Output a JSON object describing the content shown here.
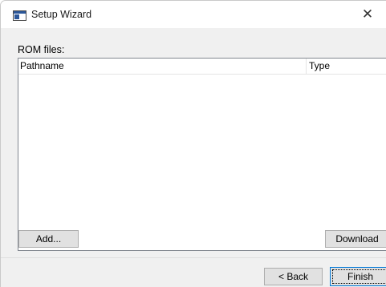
{
  "window": {
    "title": "Setup Wizard",
    "close_glyph": "✕"
  },
  "rom_files": {
    "label": "ROM files:",
    "columns": [
      "Pathname",
      "Type"
    ],
    "rows": []
  },
  "buttons": {
    "add": "Add...",
    "download": "Download",
    "back": "< Back",
    "finish": "Finish"
  },
  "icons": {
    "app": "window-app-icon",
    "close": "close-icon"
  },
  "colors": {
    "focus_border": "#0078d7",
    "list_border": "#828790"
  }
}
